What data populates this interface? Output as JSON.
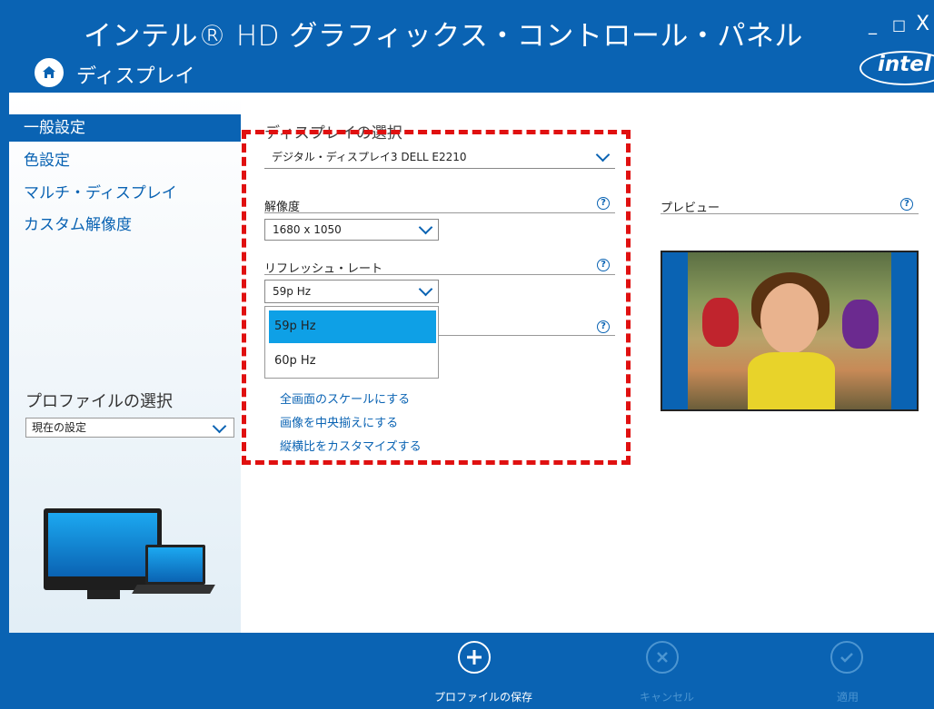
{
  "header": {
    "title": "インテル® HD グラフィックス・コントロール・パネル",
    "section": "ディスプレイ",
    "logo_text": "intel",
    "window_min": "_",
    "window_max": "□",
    "window_close": "X"
  },
  "sidebar": {
    "items": [
      {
        "label": "一般設定",
        "active": true
      },
      {
        "label": "色設定",
        "active": false
      },
      {
        "label": "マルチ・ディスプレイ",
        "active": false
      },
      {
        "label": "カスタム解像度",
        "active": false
      }
    ],
    "profile_label": "プロファイルの選択",
    "profile_value": "現在の設定"
  },
  "main": {
    "display_select_label": "ディスプレイの選択",
    "display_value": "デジタル・ディスプレイ3 DELL E2210",
    "resolution_label": "解像度",
    "resolution_value": "1680 x 1050",
    "refresh_label": "リフレッシュ・レート",
    "refresh_value": "59p Hz",
    "refresh_options": [
      "59p Hz",
      "60p Hz"
    ],
    "help_glyph": "?",
    "scaling_links": [
      "全画面のスケールにする",
      "画像を中央揃えにする",
      "縦横比をカスタマイズする"
    ]
  },
  "preview": {
    "label": "プレビュー"
  },
  "footer": {
    "save_label": "プロファイルの保存",
    "cancel_label": "キャンセル",
    "apply_label": "適用"
  },
  "colors": {
    "brand_blue": "#0a63b3",
    "selection_blue": "#0ea0e6",
    "highlight_red": "#e01010"
  }
}
